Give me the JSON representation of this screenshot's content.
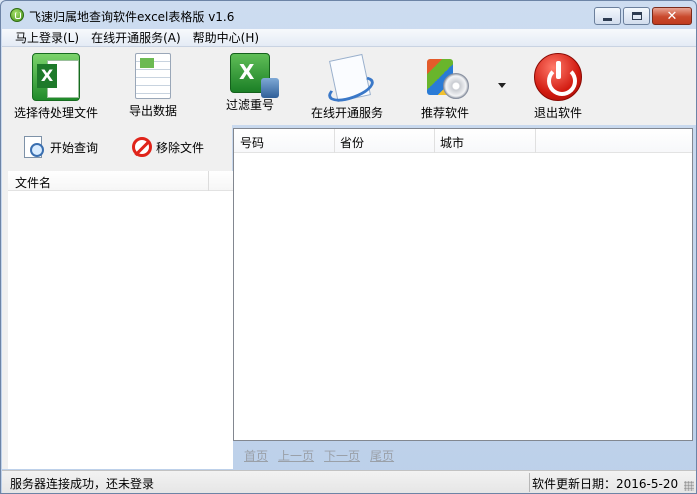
{
  "window": {
    "title": "飞速归属地查询软件excel表格版 v1.6"
  },
  "menu": {
    "items": [
      "马上登录(L)",
      "在线开通服务(A)",
      "帮助中心(H)"
    ]
  },
  "toolbar": {
    "select_files": "选择待处理文件",
    "export_data": "导出数据",
    "filter_duplicates": "过滤重号",
    "online_service": "在线开通服务",
    "recommend_software": "推荐软件",
    "exit_software": "退出软件"
  },
  "left_panel": {
    "start_query": "开始查询",
    "remove_file": "移除文件",
    "file_column": "文件名"
  },
  "table": {
    "columns": [
      "号码",
      "省份",
      "城市"
    ],
    "rows": []
  },
  "pager": {
    "first": "首页",
    "prev": "上一页",
    "next": "下一页",
    "last": "尾页"
  },
  "status": {
    "left": "服务器连接成功，还未登录",
    "right": "软件更新日期：2016-5-20"
  },
  "icons": {
    "app": "app-logo-icon",
    "select_files": "excel-icon",
    "export_data": "spreadsheet-document-icon",
    "filter_duplicates": "excel-database-icon",
    "online_service": "document-globe-icon",
    "recommend_software": "software-box-icon",
    "exit_software": "power-icon",
    "start_query": "document-search-icon",
    "remove_file": "prohibited-icon"
  },
  "colors": {
    "title_bar": "#c5d7ee",
    "close_button": "#c9492c",
    "exit_icon": "#d11a10"
  }
}
